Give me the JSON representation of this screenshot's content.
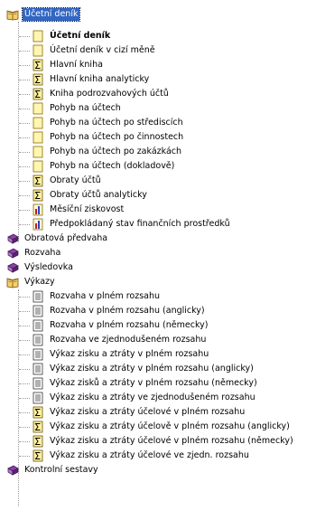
{
  "tree": {
    "root": {
      "label": "Účetní deník",
      "icon": "open-book-icon",
      "children": [
        {
          "label": "Účetní deník",
          "icon": "document-icon",
          "bold": true
        },
        {
          "label": "Účetní deník v cizí měně",
          "icon": "document-icon"
        },
        {
          "label": "Hlavní kniha",
          "icon": "sigma-icon"
        },
        {
          "label": "Hlavní kniha analyticky",
          "icon": "sigma-icon"
        },
        {
          "label": "Kniha podrozvahových účtů",
          "icon": "sigma-icon"
        },
        {
          "label": "Pohyb na účtech",
          "icon": "document-icon"
        },
        {
          "label": "Pohyb na účtech po střediscích",
          "icon": "document-icon"
        },
        {
          "label": "Pohyb na účtech po činnostech",
          "icon": "document-icon"
        },
        {
          "label": "Pohyb na účtech po zakázkách",
          "icon": "document-icon"
        },
        {
          "label": "Pohyb na účtech (dokladově)",
          "icon": "document-icon"
        },
        {
          "label": "Obraty účtů",
          "icon": "sigma-icon"
        },
        {
          "label": "Obraty účtů analyticky",
          "icon": "sigma-icon"
        },
        {
          "label": "Měsíční ziskovost",
          "icon": "chart-icon"
        },
        {
          "label": "Předpokládaný stav finančních prostředků",
          "icon": "chart-icon"
        }
      ]
    },
    "groups": [
      {
        "label": "Obratová předvaha",
        "icon": "closed-book-icon"
      },
      {
        "label": "Rozvaha",
        "icon": "closed-book-icon"
      },
      {
        "label": "Výsledovka",
        "icon": "closed-book-icon"
      }
    ],
    "vykazy": {
      "label": "Výkazy",
      "icon": "open-book-icon",
      "children": [
        {
          "label": "Rozvaha v plném rozsahu",
          "icon": "report-icon"
        },
        {
          "label": "Rozvaha v plném rozsahu (anglicky)",
          "icon": "report-icon"
        },
        {
          "label": "Rozvaha v plném rozsahu (německy)",
          "icon": "report-icon"
        },
        {
          "label": "Rozvaha ve zjednodušeném rozsahu",
          "icon": "report-icon"
        },
        {
          "label": "Výkaz zisku a ztráty v plném rozsahu",
          "icon": "report-icon"
        },
        {
          "label": "Výkaz zisku a ztráty v plném rozsahu (anglicky)",
          "icon": "report-icon"
        },
        {
          "label": "Výkaz zisků a ztráty v plném rozsahu (německy)",
          "icon": "report-icon"
        },
        {
          "label": "Výkaz zisku a ztráty ve zjednodušeném rozsahu",
          "icon": "report-icon"
        },
        {
          "label": "Výkaz zisku a ztráty účelové v plném rozsahu",
          "icon": "sigma-doc-icon"
        },
        {
          "label": "Výkaz zisku a ztráty účelově v plném rozsahu (anglicky)",
          "icon": "sigma-doc-icon"
        },
        {
          "label": "Výkaz zisku a ztráty účelové v plném rozsahu (německy)",
          "icon": "sigma-doc-icon"
        },
        {
          "label": "Výkaz zisku a ztráty účelové ve zjedn. rozsahu",
          "icon": "sigma-doc-icon"
        }
      ]
    },
    "last": {
      "label": "Kontrolní sestavy",
      "icon": "closed-book-icon"
    }
  }
}
